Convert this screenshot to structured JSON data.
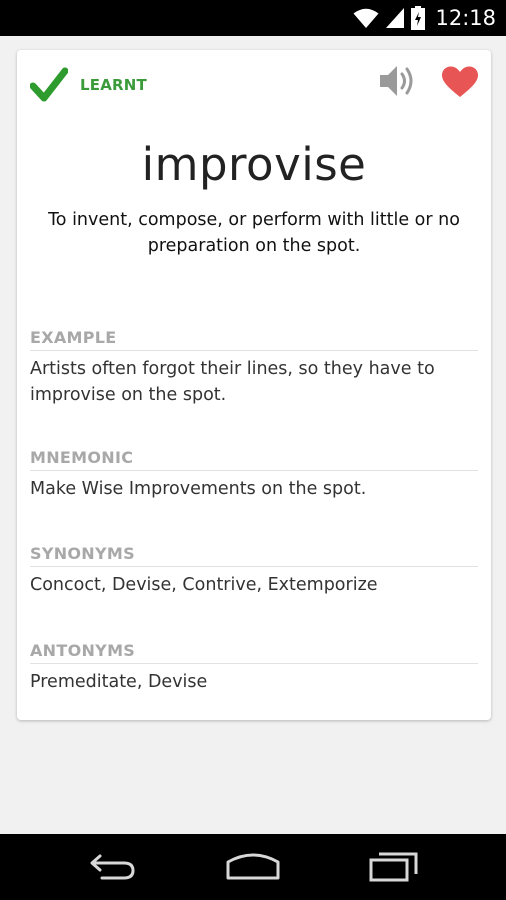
{
  "status_bar": {
    "time": "12:18",
    "icons": [
      "wifi-icon",
      "signal-icon",
      "battery-icon"
    ]
  },
  "card": {
    "learnt_label": "LEARNT",
    "learnt_color": "#3b9b3b",
    "heart_color": "#e85555",
    "word": "improvise",
    "definition": "To invent, compose, or perform with little or no preparation on the spot.",
    "sections": [
      {
        "title": "EXAMPLE",
        "text": "Artists often forgot their lines, so they have to improvise on the spot."
      },
      {
        "title": "MNEMONIC",
        "text": "Make Wise Improvements on the spot."
      },
      {
        "title": "SYNONYMS",
        "text": "Concoct, Devise, Contrive, Extemporize"
      },
      {
        "title": "ANTONYMS",
        "text": "Premeditate, Devise"
      }
    ]
  },
  "nav_bar": {
    "icons": [
      "back-icon",
      "home-icon",
      "recents-icon"
    ]
  }
}
